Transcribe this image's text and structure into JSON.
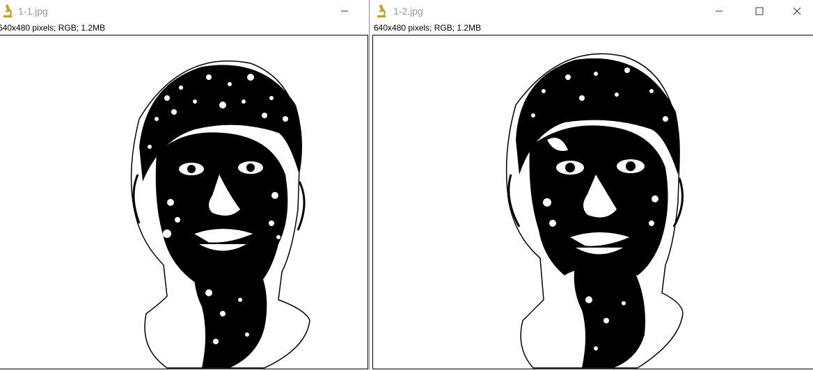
{
  "windows": [
    {
      "title": "1-1.jpg",
      "info": "640x480 pixels; RGB; 1.2MB",
      "app_icon": "microscope-icon",
      "controls": [
        "minimize"
      ]
    },
    {
      "title": "1-2.jpg",
      "info": "640x480 pixels; RGB; 1.2MB",
      "app_icon": "microscope-icon",
      "controls": [
        "minimize",
        "maximize",
        "close"
      ]
    }
  ],
  "colors": {
    "icon_accent": "#c8a020",
    "title_text": "#9a9a9a",
    "image_foreground": "#000000",
    "image_background": "#ffffff"
  }
}
